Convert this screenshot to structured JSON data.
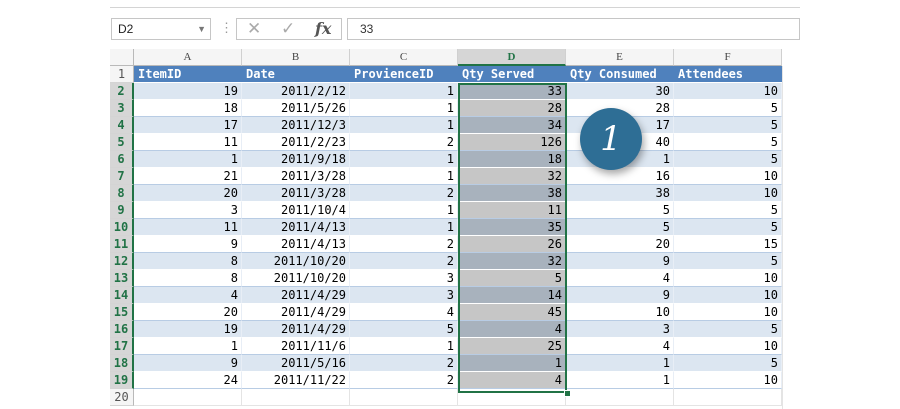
{
  "formula_bar": {
    "name_box": "D2",
    "formula": "33",
    "cancel_icon": "cancel-icon",
    "enter_icon": "enter-icon",
    "fx_label": "fx"
  },
  "columns": [
    "A",
    "B",
    "C",
    "D",
    "E",
    "F"
  ],
  "selected_column": "D",
  "header_row": [
    "ItemID",
    "Date",
    "ProvienceID",
    "Qty Served",
    "Qty Consumed",
    "Attendees"
  ],
  "rows": [
    [
      "19",
      "2011/2/12",
      "1",
      "33",
      "30",
      "10"
    ],
    [
      "18",
      "2011/5/26",
      "1",
      "28",
      "28",
      "5"
    ],
    [
      "17",
      "2011/12/3",
      "1",
      "34",
      "17",
      "5"
    ],
    [
      "11",
      "2011/2/23",
      "2",
      "126",
      "40",
      "5"
    ],
    [
      "1",
      "2011/9/18",
      "1",
      "18",
      "1",
      "5"
    ],
    [
      "21",
      "2011/3/28",
      "1",
      "32",
      "16",
      "10"
    ],
    [
      "20",
      "2011/3/28",
      "2",
      "38",
      "38",
      "10"
    ],
    [
      "3",
      "2011/10/4",
      "1",
      "11",
      "5",
      "5"
    ],
    [
      "11",
      "2011/4/13",
      "1",
      "35",
      "5",
      "5"
    ],
    [
      "9",
      "2011/4/13",
      "2",
      "26",
      "20",
      "15"
    ],
    [
      "8",
      "2011/10/20",
      "2",
      "32",
      "9",
      "5"
    ],
    [
      "8",
      "2011/10/20",
      "3",
      "5",
      "4",
      "10"
    ],
    [
      "4",
      "2011/4/29",
      "3",
      "14",
      "9",
      "10"
    ],
    [
      "20",
      "2011/4/29",
      "4",
      "45",
      "10",
      "10"
    ],
    [
      "19",
      "2011/4/29",
      "5",
      "4",
      "3",
      "5"
    ],
    [
      "1",
      "2011/11/6",
      "1",
      "25",
      "4",
      "10"
    ],
    [
      "9",
      "2011/5/16",
      "2",
      "1",
      "1",
      "5"
    ],
    [
      "24",
      "2011/11/22",
      "2",
      "4",
      "1",
      "10"
    ]
  ],
  "row_numbers": [
    "1",
    "2",
    "3",
    "4",
    "5",
    "6",
    "7",
    "8",
    "9",
    "10",
    "11",
    "12",
    "13",
    "14",
    "15",
    "16",
    "17",
    "18",
    "19",
    "20"
  ],
  "callout_label": "1",
  "colors": {
    "header_fill": "#4f81bd",
    "band_fill": "#dce6f1",
    "selection_border": "#217346",
    "callout_fill": "#2e6e95"
  }
}
